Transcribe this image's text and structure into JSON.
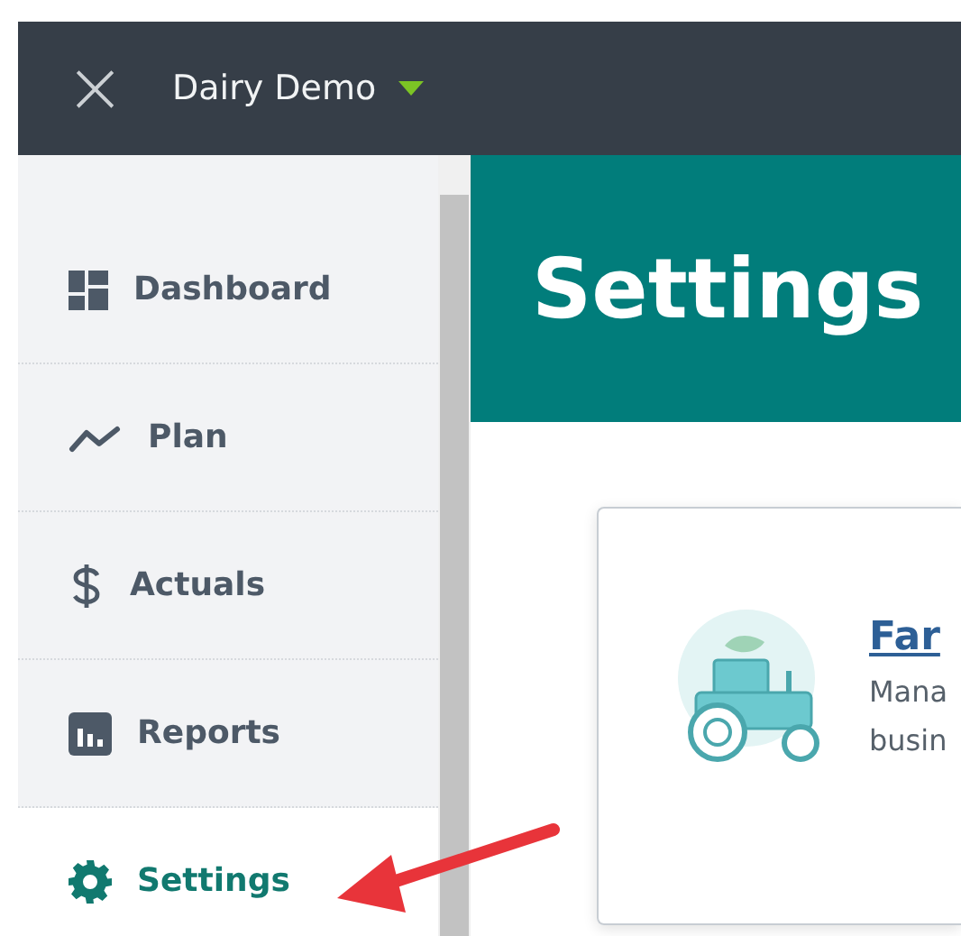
{
  "topbar": {
    "close": "×",
    "title": "Dairy Demo"
  },
  "sidebar": {
    "items": [
      {
        "label": "Dashboard",
        "kind": "dashboard",
        "selected": false
      },
      {
        "label": "Plan",
        "kind": "plan",
        "selected": false
      },
      {
        "label": "Actuals",
        "kind": "actuals",
        "selected": false
      },
      {
        "label": "Reports",
        "kind": "reports",
        "selected": false
      },
      {
        "label": "Settings",
        "kind": "settings",
        "selected": true
      }
    ]
  },
  "header": {
    "title": "Settings"
  },
  "card": {
    "link": "Far",
    "lines": [
      "Mana",
      "busin"
    ]
  }
}
